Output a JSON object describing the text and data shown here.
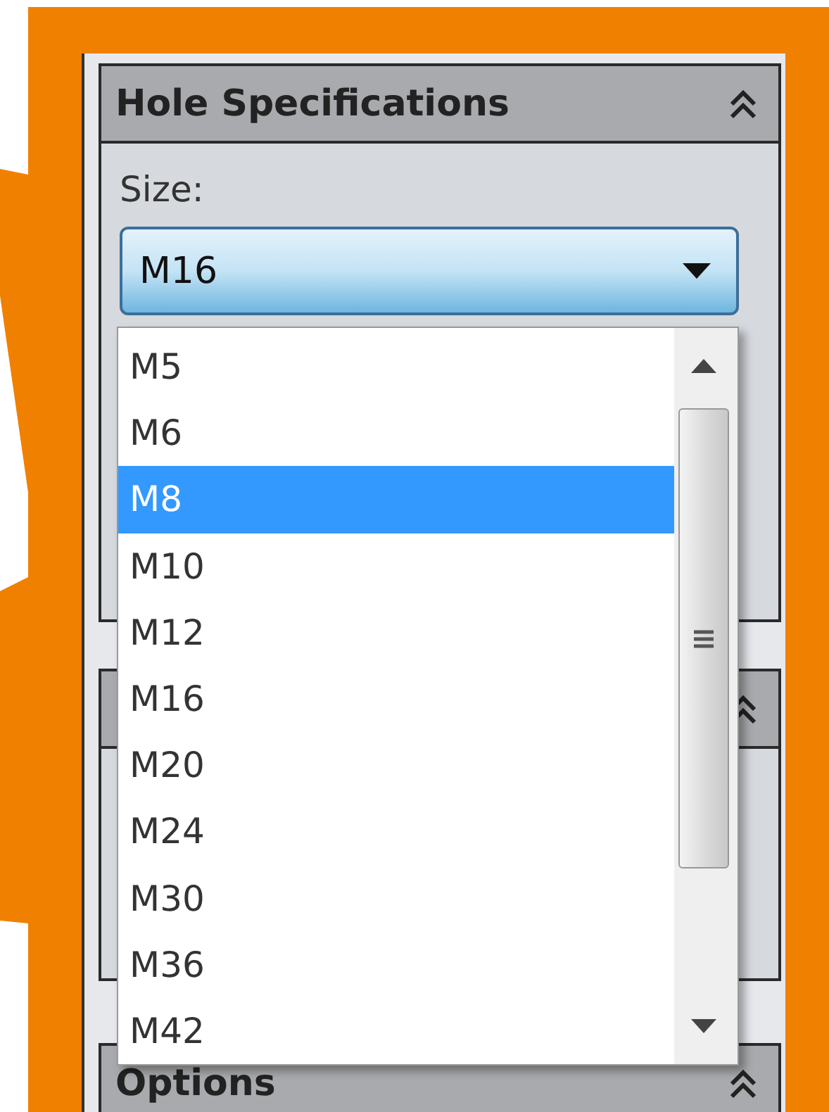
{
  "sections": [
    {
      "title": "Hole Specifications",
      "expanded": true
    },
    {
      "expanded": true
    },
    {
      "title": "Options",
      "expanded": true
    }
  ],
  "size_field": {
    "label": "Size:",
    "value": "M16"
  },
  "size_list": [
    {
      "label": "M5",
      "selected": false
    },
    {
      "label": "M6",
      "selected": false
    },
    {
      "label": "M8",
      "selected": true
    },
    {
      "label": "M10",
      "selected": false
    },
    {
      "label": "M12",
      "selected": false
    },
    {
      "label": "M16",
      "selected": false
    },
    {
      "label": "M20",
      "selected": false
    },
    {
      "label": "M24",
      "selected": false
    },
    {
      "label": "M30",
      "selected": false
    },
    {
      "label": "M36",
      "selected": false
    },
    {
      "label": "M42",
      "selected": false
    }
  ]
}
